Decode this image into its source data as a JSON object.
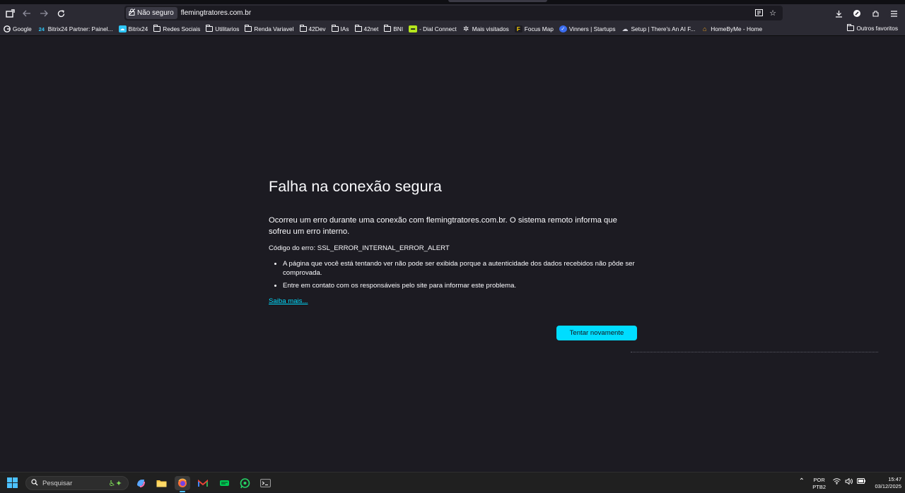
{
  "browser": {
    "security_label": "Não seguro",
    "url": "flemingtratores.com.br"
  },
  "bookmarks": [
    {
      "label": "Google",
      "icon": "google-icon"
    },
    {
      "label": "Bitrix24 Partner: Painel...",
      "icon": "bitrix-icon"
    },
    {
      "label": "Bitrix24",
      "icon": "bitrix-cloud-icon"
    },
    {
      "label": "Redes Sociais",
      "icon": "folder-icon"
    },
    {
      "label": "Utilitarios",
      "icon": "folder-icon"
    },
    {
      "label": "Renda Variavel",
      "icon": "folder-icon"
    },
    {
      "label": "42Dev",
      "icon": "folder-icon"
    },
    {
      "label": "IAs",
      "icon": "folder-icon"
    },
    {
      "label": "42net",
      "icon": "folder-icon"
    },
    {
      "label": "BNI",
      "icon": "folder-icon"
    },
    {
      "label": "- Dial Connect",
      "icon": "dial-icon"
    },
    {
      "label": "Mais visitados",
      "icon": "gear-icon"
    },
    {
      "label": "Focus Map",
      "icon": "focus-icon"
    },
    {
      "label": "Vinners | Startups",
      "icon": "check-icon"
    },
    {
      "label": "Setup | There's An AI F...",
      "icon": "setup-icon"
    },
    {
      "label": "HomeByMe - Home",
      "icon": "home-icon"
    }
  ],
  "other_bookmarks": "Outros favoritos",
  "error": {
    "title": "Falha na conexão segura",
    "description": "Ocorreu um erro durante uma conexão com flemingtratores.com.br. O sistema remoto informa que sofreu um erro interno.",
    "code": "Código do erro: SSL_ERROR_INTERNAL_ERROR_ALERT",
    "bullets": [
      "A página que você está tentando ver não pode ser exibida porque a autenticidade dos dados recebidos não pôde ser comprovada.",
      "Entre em contato com os responsáveis pelo site para informar este problema."
    ],
    "learn_more": "Saiba mais...",
    "retry_button": "Tentar novamente"
  },
  "taskbar": {
    "search_placeholder": "Pesquisar",
    "lang_line1": "POR",
    "lang_line2": "PTB2",
    "time": "15:47",
    "date": "03/12/2025"
  },
  "colors": {
    "page_bg": "#1c1b22",
    "toolbar_bg": "#2b2a33",
    "accent": "#00ddff",
    "taskbar_bg": "#202020"
  }
}
